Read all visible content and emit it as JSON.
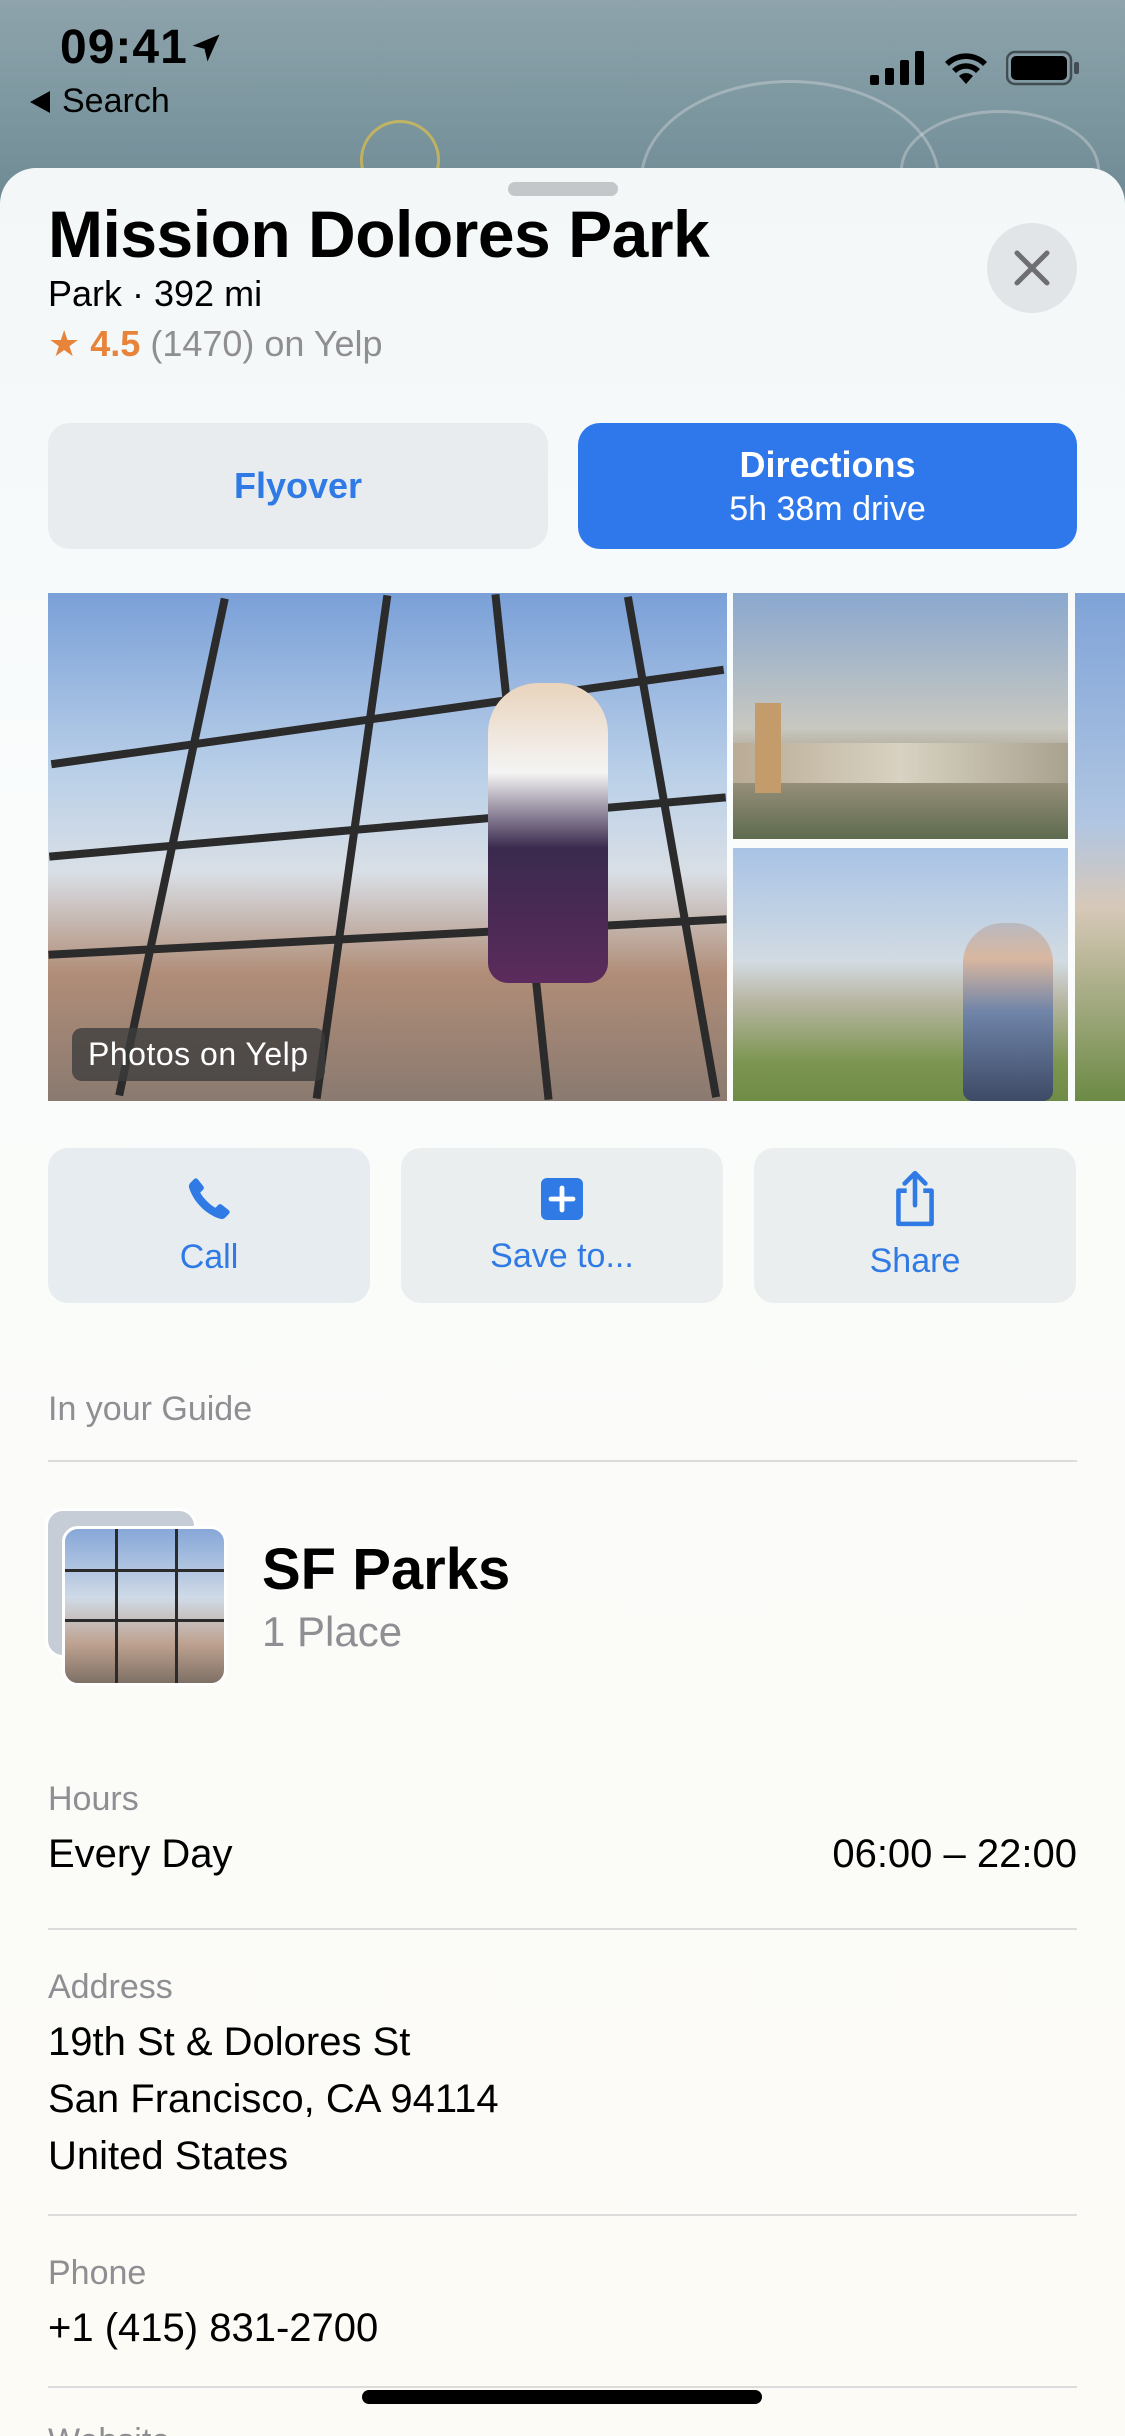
{
  "status_bar": {
    "time": "09:41",
    "back_label": "Search"
  },
  "place": {
    "name": "Mission Dolores Park",
    "category_distance": "Park · 392 mi",
    "rating": {
      "score": "4.5",
      "count_text": "(1470) on Yelp"
    }
  },
  "buttons": {
    "flyover": "Flyover",
    "directions_title": "Directions",
    "directions_sub": "5h 38m drive"
  },
  "photos": {
    "label": "Photos on Yelp"
  },
  "actions": {
    "call": "Call",
    "save": "Save to...",
    "share": "Share"
  },
  "guide": {
    "section": "In your Guide",
    "title": "SF Parks",
    "count": "1 Place"
  },
  "hours": {
    "label": "Hours",
    "days": "Every Day",
    "time": "06:00 – 22:00"
  },
  "address": {
    "label": "Address",
    "line1": "19th St & Dolores St",
    "line2": "San Francisco, CA 94114",
    "line3": "United States"
  },
  "phone": {
    "label": "Phone",
    "number": "+1 (415) 831-2700"
  },
  "website": {
    "label": "Website"
  },
  "colors": {
    "accent": "#2f7ae5",
    "rating": "#e8833a"
  }
}
